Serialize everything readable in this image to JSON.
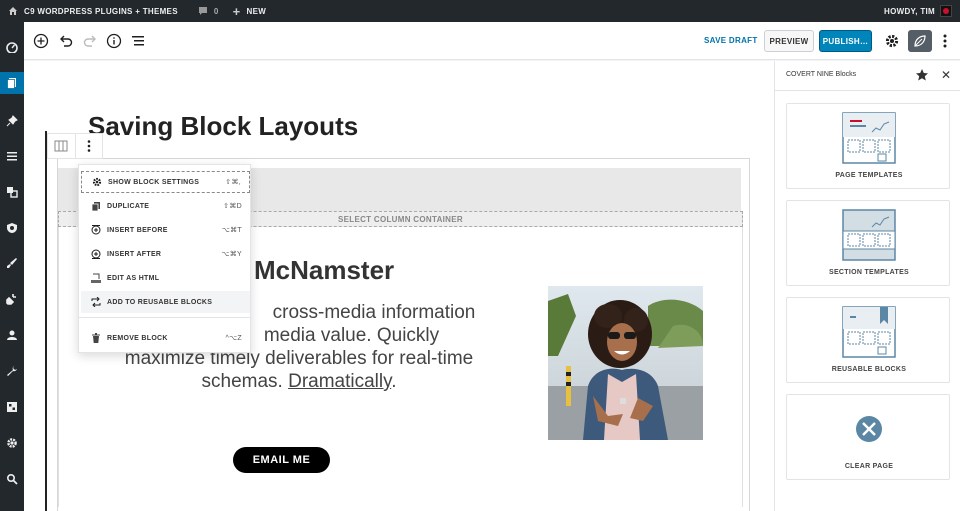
{
  "adminbar": {
    "site_name": "C9 WORDPRESS PLUGINS + THEMES",
    "comments_count": "0",
    "new_label": "NEW",
    "greeting": "HOWDY, TIM"
  },
  "admin_menu": {
    "icons": [
      "dashboard-icon",
      "pages-icon",
      "pin-icon",
      "menu-icon",
      "media-icon",
      "shield-icon",
      "brush-icon",
      "plugin-icon",
      "users-icon",
      "tools-icon",
      "blocks-icon",
      "settings-icon",
      "search-icon"
    ],
    "active_index": 1
  },
  "header": {
    "save_draft": "SAVE DRAFT",
    "preview": "PREVIEW",
    "publish": "PUBLISH…"
  },
  "editor": {
    "post_title": "Saving Block Layouts",
    "column_container": "SELECT COLUMN CONTAINER",
    "hero_name": "McNamster",
    "hero_line1": "cross-media information",
    "hero_line2": "media value. Quickly",
    "hero_line3": "maximize timely deliverables for real-time",
    "hero_line4_pre": "schemas. ",
    "hero_line4_link": "Dramatically",
    "hero_line4_post": ".",
    "email_button": "EMAIL ME"
  },
  "block_menu": {
    "items": [
      {
        "label": "SHOW BLOCK SETTINGS",
        "shortcut": "⇧⌘,",
        "icon": "gear-icon"
      },
      {
        "label": "DUPLICATE",
        "shortcut": "⇧⌘D",
        "icon": "duplicate-icon"
      },
      {
        "label": "INSERT BEFORE",
        "shortcut": "⌥⌘T",
        "icon": "insert-before-icon"
      },
      {
        "label": "INSERT AFTER",
        "shortcut": "⌥⌘Y",
        "icon": "insert-after-icon"
      },
      {
        "label": "EDIT AS HTML",
        "shortcut": "",
        "icon": "html-icon"
      },
      {
        "label": "ADD TO REUSABLE BLOCKS",
        "shortcut": "",
        "icon": "reusable-icon"
      },
      {
        "label": "REMOVE BLOCK",
        "shortcut": "^⌥Z",
        "icon": "trash-icon"
      }
    ]
  },
  "sidebar": {
    "title": "COVERT NINE Blocks",
    "cards": [
      {
        "label": "PAGE TEMPLATES"
      },
      {
        "label": "SECTION TEMPLATES"
      },
      {
        "label": "REUSABLE BLOCKS"
      },
      {
        "label": "CLEAR PAGE"
      }
    ]
  },
  "colors": {
    "admin_bg": "#23282d",
    "accent": "#0085ba",
    "link": "#0073aa",
    "card_art": "#5b87a5"
  }
}
